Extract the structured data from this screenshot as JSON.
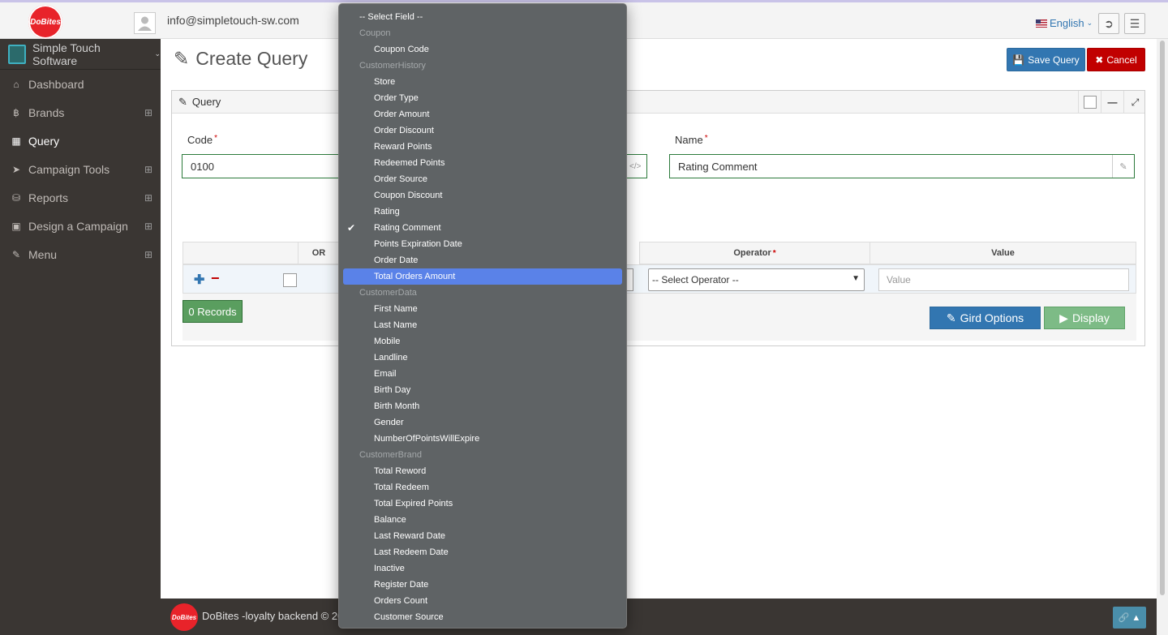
{
  "app": {
    "logo_text": "DoBites",
    "user_email": "info@simpletouch-sw.com",
    "language": "English"
  },
  "sidebar": {
    "org": "Simple Touch Software",
    "items": [
      {
        "label": "Dashboard",
        "icon": "home-icon"
      },
      {
        "label": "Brands",
        "icon": "bitcoin-icon"
      },
      {
        "label": "Query",
        "icon": "puzzle-icon"
      },
      {
        "label": "Campaign Tools",
        "icon": "paper-plane-icon"
      },
      {
        "label": "Reports",
        "icon": "database-icon"
      },
      {
        "label": "Design a Campaign",
        "icon": "briefcase-icon"
      },
      {
        "label": "Menu",
        "icon": "edit-icon"
      }
    ]
  },
  "page": {
    "title": "Create Query",
    "save_label": "Save Query",
    "cancel_label": "Cancel"
  },
  "widget": {
    "title": "Query",
    "code_label": "Code",
    "code_value": "0100",
    "name_label": "Name",
    "name_value": "Rating Comment",
    "grid_headers": {
      "or": "OR",
      "operator": "Operator",
      "value": "Value"
    },
    "operator_selected": "-- Select Operator --",
    "value_placeholder": "Value",
    "grid_options_label": "Gird Options",
    "display_label": "Display",
    "records_label": "0 Records"
  },
  "dropdown": {
    "first": "-- Select Field --",
    "groups": [
      {
        "name": "Coupon",
        "items": [
          "Coupon Code"
        ]
      },
      {
        "name": "CustomerHistory",
        "items": [
          "Store",
          "Order Type",
          "Order Amount",
          "Order Discount",
          "Reward Points",
          "Redeemed Points",
          "Order Source",
          "Coupon Discount",
          "Rating",
          "Rating Comment",
          "Points Expiration Date",
          "Order Date",
          "Total Orders Amount"
        ]
      },
      {
        "name": "CustomerData",
        "items": [
          "First Name",
          "Last Name",
          "Mobile",
          "Landline",
          "Email",
          "Birth Day",
          "Birth Month",
          "Gender",
          "NumberOfPointsWillExpire"
        ]
      },
      {
        "name": "CustomerBrand",
        "items": [
          "Total Reword",
          "Total Redeem",
          "Total Expired Points",
          "Balance",
          "Last Reward Date",
          "Last Redeem Date",
          "Inactive",
          "Register Date",
          "Orders Count",
          "Customer Source"
        ]
      }
    ],
    "checked": "Rating Comment",
    "highlighted": "Total Orders Amount"
  },
  "footer": {
    "logo_text": "DoBites",
    "text": "DoBites -loyalty backend © 202"
  }
}
